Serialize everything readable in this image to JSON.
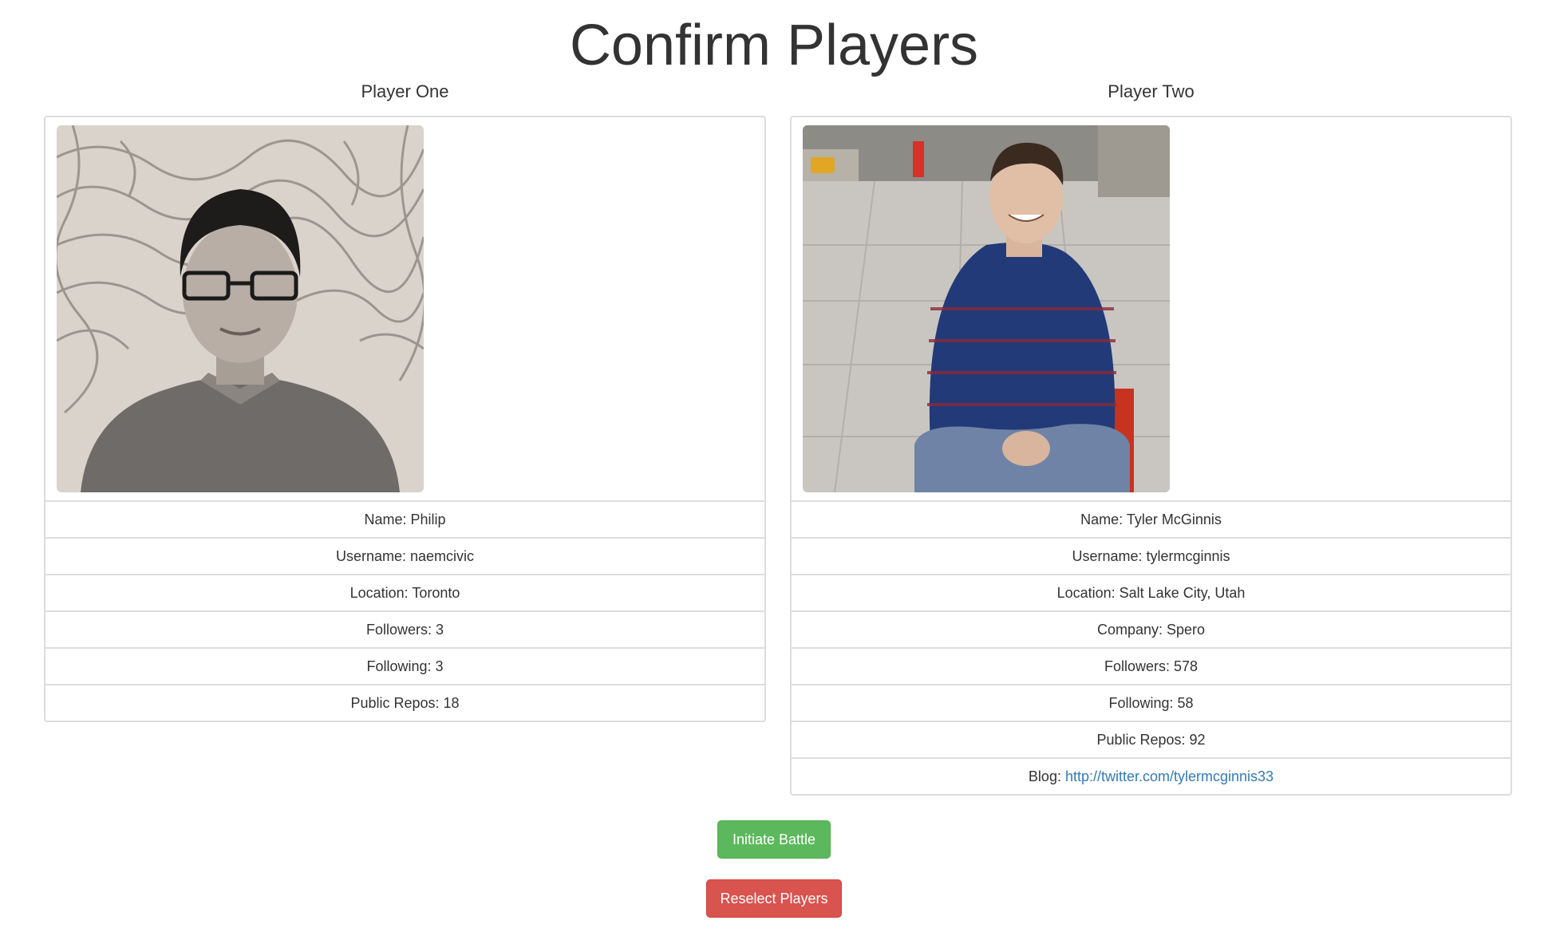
{
  "page": {
    "title": "Confirm Players"
  },
  "players": [
    {
      "heading": "Player One",
      "fields": [
        {
          "label": "Name: ",
          "value": "Philip"
        },
        {
          "label": "Username: ",
          "value": "naemcivic"
        },
        {
          "label": "Location: ",
          "value": "Toronto"
        },
        {
          "label": "Followers: ",
          "value": "3"
        },
        {
          "label": "Following: ",
          "value": "3"
        },
        {
          "label": "Public Repos: ",
          "value": "18"
        }
      ]
    },
    {
      "heading": "Player Two",
      "fields": [
        {
          "label": "Name: ",
          "value": "Tyler McGinnis"
        },
        {
          "label": "Username: ",
          "value": "tylermcginnis"
        },
        {
          "label": "Location: ",
          "value": "Salt Lake City, Utah"
        },
        {
          "label": "Company: ",
          "value": "Spero"
        },
        {
          "label": "Followers: ",
          "value": "578"
        },
        {
          "label": "Following: ",
          "value": "58"
        },
        {
          "label": "Public Repos: ",
          "value": "92"
        },
        {
          "label": "Blog: ",
          "value": "http://twitter.com/tylermcginnis33"
        }
      ]
    }
  ],
  "actions": {
    "initiate_label": "Initiate Battle",
    "reselect_label": "Reselect Players"
  },
  "colors": {
    "success": "#5cb85c",
    "danger": "#d9534f",
    "link": "#337ab7"
  }
}
